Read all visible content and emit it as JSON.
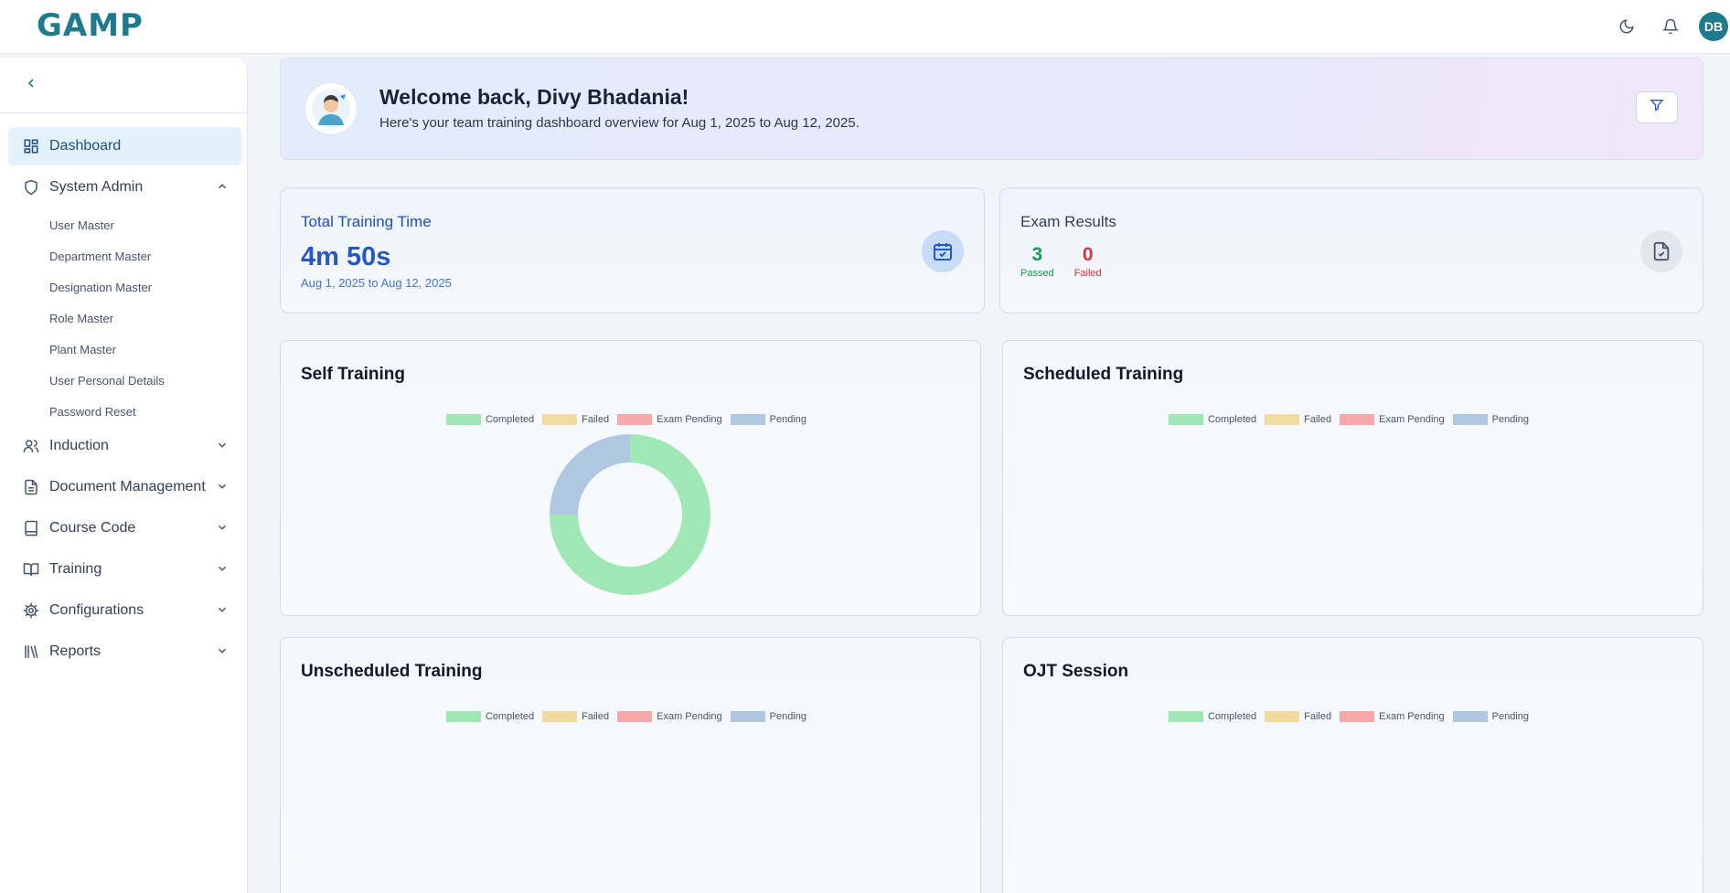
{
  "header": {
    "logo_text": "GAMP",
    "user_initials": "DB",
    "icons": [
      "moon-icon",
      "bell-icon"
    ]
  },
  "sidebar": {
    "items": [
      {
        "label": "Dashboard",
        "icon": "dashboard-icon",
        "active": true
      },
      {
        "label": "System Admin",
        "icon": "shield-icon",
        "expanded": true
      },
      {
        "label": "Induction",
        "icon": "users-icon"
      },
      {
        "label": "Document Management",
        "icon": "document-icon"
      },
      {
        "label": "Course Code",
        "icon": "book-icon"
      },
      {
        "label": "Training",
        "icon": "open-book-icon"
      },
      {
        "label": "Configurations",
        "icon": "gear-icon"
      },
      {
        "label": "Reports",
        "icon": "library-icon"
      }
    ],
    "system_admin_children": [
      "User Master",
      "Department Master",
      "Designation Master",
      "Role Master",
      "Plant Master",
      "User Personal Details",
      "Password Reset"
    ]
  },
  "welcome": {
    "title": "Welcome back, Divy Bhadania!",
    "subtitle": "Here's your team training dashboard overview for Aug 1, 2025 to Aug 12, 2025."
  },
  "stats": {
    "training_time": {
      "title": "Total Training Time",
      "value": "4m 50s",
      "range": "Aug 1, 2025 to Aug 12, 2025"
    },
    "exam_results": {
      "title": "Exam Results",
      "passed": "3",
      "passed_label": "Passed",
      "failed": "0",
      "failed_label": "Failed"
    }
  },
  "legend": [
    "Completed",
    "Failed",
    "Exam Pending",
    "Pending"
  ],
  "colors": {
    "completed": "#9fe8b6",
    "failed": "#f2dba0",
    "exam_pending": "#f7a9a9",
    "pending": "#b0c7e2",
    "accent": "#1f7a8c"
  },
  "chart_data": [
    {
      "type": "pie",
      "title": "Self Training",
      "categories": [
        "Completed",
        "Failed",
        "Exam Pending",
        "Pending"
      ],
      "values": [
        3,
        0,
        0,
        1
      ]
    },
    {
      "type": "pie",
      "title": "Scheduled Training",
      "categories": [
        "Completed",
        "Failed",
        "Exam Pending",
        "Pending"
      ],
      "values": []
    },
    {
      "type": "pie",
      "title": "Unscheduled Training",
      "categories": [
        "Completed",
        "Failed",
        "Exam Pending",
        "Pending"
      ],
      "values": []
    },
    {
      "type": "pie",
      "title": "OJT Session",
      "categories": [
        "Completed",
        "Failed",
        "Exam Pending",
        "Pending"
      ],
      "values": []
    }
  ]
}
